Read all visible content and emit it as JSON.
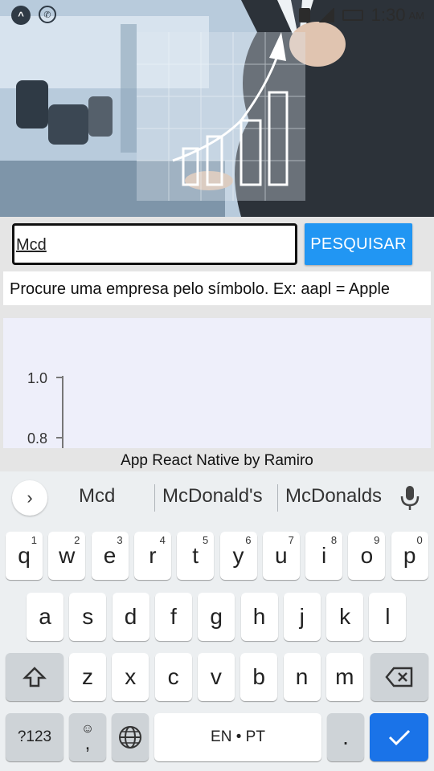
{
  "status_bar": {
    "time": "1:30",
    "ampm": "AM",
    "left_icons": [
      "app-icon",
      "whatsapp-icon"
    ]
  },
  "search": {
    "value": "Mcd",
    "button_label": "PESQUISAR"
  },
  "hint": "Procure uma empresa pelo símbolo. Ex: aapl = Apple",
  "chart_data": {
    "type": "line",
    "y_ticks": [
      "1.0",
      "0.8"
    ],
    "series": []
  },
  "footer": "App React Native by Ramiro",
  "keyboard": {
    "suggestions": [
      "Mcd",
      "McDonald's",
      "McDonalds"
    ],
    "row1": [
      {
        "k": "q",
        "n": "1"
      },
      {
        "k": "w",
        "n": "2"
      },
      {
        "k": "e",
        "n": "3"
      },
      {
        "k": "r",
        "n": "4"
      },
      {
        "k": "t",
        "n": "5"
      },
      {
        "k": "y",
        "n": "6"
      },
      {
        "k": "u",
        "n": "7"
      },
      {
        "k": "i",
        "n": "8"
      },
      {
        "k": "o",
        "n": "9"
      },
      {
        "k": "p",
        "n": "0"
      }
    ],
    "row2": [
      "a",
      "s",
      "d",
      "f",
      "g",
      "h",
      "j",
      "k",
      "l"
    ],
    "row3": [
      "z",
      "x",
      "c",
      "v",
      "b",
      "n",
      "m"
    ],
    "symbols_label": "?123",
    "comma": ",",
    "space_label": "EN • PT",
    "period": ".",
    "colors": {
      "accent": "#2196f3",
      "enter": "#1a73e8"
    }
  }
}
